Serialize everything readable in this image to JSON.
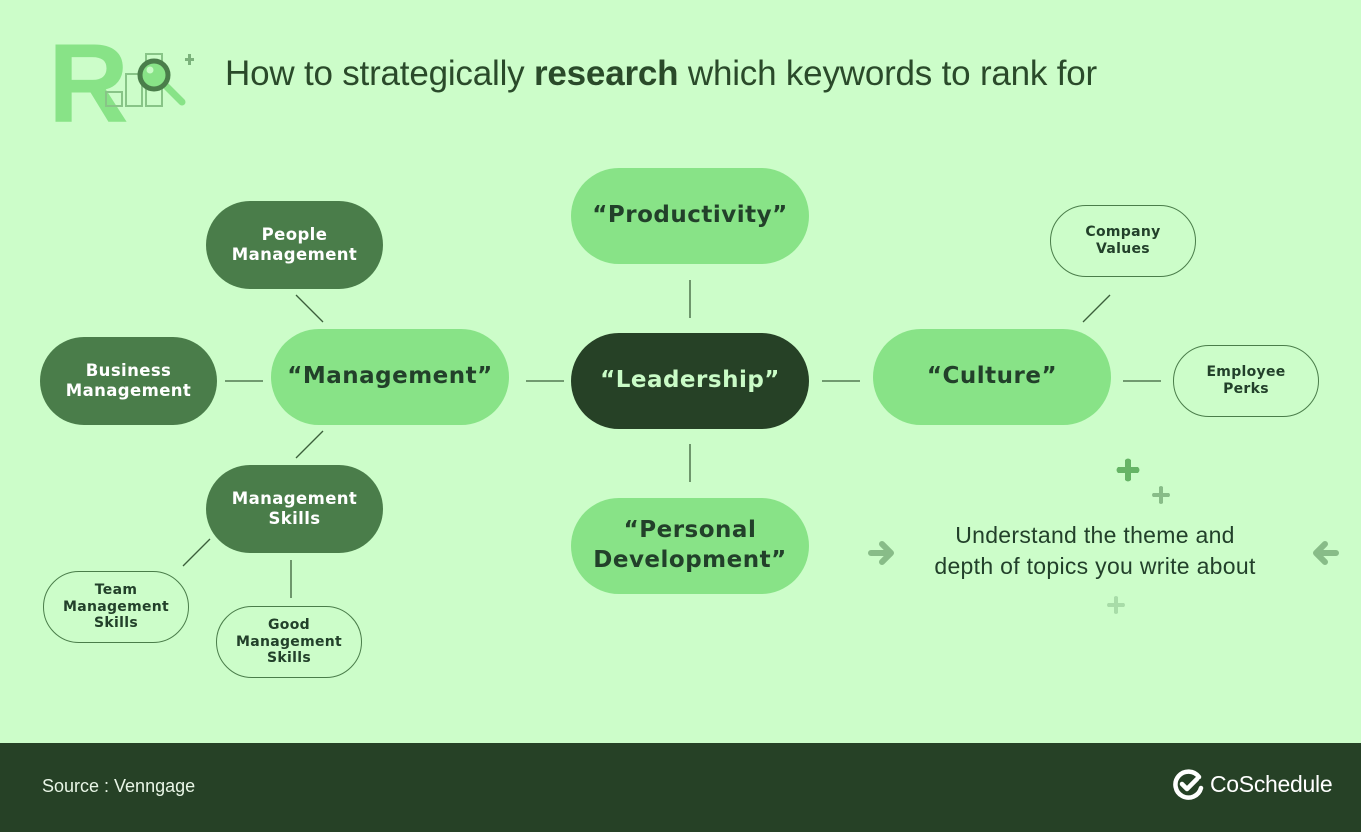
{
  "header": {
    "title_prefix": "How to strategically ",
    "title_bold": "research",
    "title_suffix": " which keywords to rank for",
    "logo_letter": "R"
  },
  "diagram": {
    "center": {
      "label": "“Leadership”"
    },
    "primary_topics": [
      {
        "id": "management",
        "label": "“Management”"
      },
      {
        "id": "productivity",
        "label": "“Productivity”"
      },
      {
        "id": "culture",
        "label": "“Culture”"
      },
      {
        "id": "personal-development",
        "label": "“Personal\nDevelopment”"
      }
    ],
    "management_subtopics": [
      {
        "id": "people-management",
        "label": "People\nManagement"
      },
      {
        "id": "business-management",
        "label": "Business\nManagement"
      },
      {
        "id": "management-skills",
        "label": "Management\nSkills"
      }
    ],
    "management_skills_subtopics": [
      {
        "id": "team-management-skills",
        "label": "Team\nManagement\nSkills"
      },
      {
        "id": "good-management-skills",
        "label": "Good\nManagement\nSkills"
      }
    ],
    "culture_subtopics": [
      {
        "id": "company-values",
        "label": "Company\nValues"
      },
      {
        "id": "employee-perks",
        "label": "Employee\nPerks"
      }
    ]
  },
  "callout": {
    "text": "Understand the theme and\ndepth of topics you write about"
  },
  "footer": {
    "source": "Source : Venngage",
    "brand": "CoSchedule"
  },
  "colors": {
    "background": "#ccfdc9",
    "dark_green": "#264126",
    "mid_green": "#4a7d4a",
    "light_green": "#88e387",
    "text_dark": "#22402a"
  }
}
